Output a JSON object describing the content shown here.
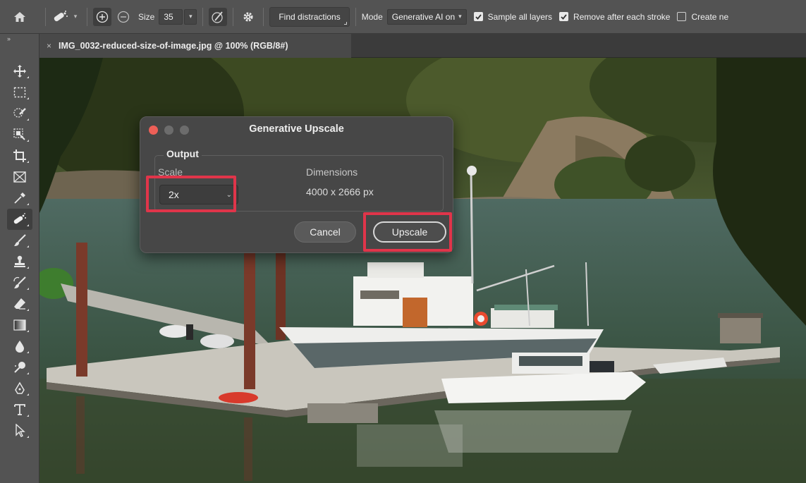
{
  "options_bar": {
    "size_label": "Size",
    "size_value": "35",
    "find_distractions": "Find distractions",
    "mode_label": "Mode",
    "mode_value": "Generative AI on",
    "sample_all_layers": "Sample all layers",
    "sample_all_layers_checked": true,
    "remove_after_stroke": "Remove after each stroke",
    "remove_after_stroke_checked": true,
    "create_new": "Create ne",
    "create_new_checked": false
  },
  "panel_collapse": "››",
  "document_tab": {
    "close": "×",
    "title": "IMG_0032-reduced-size-of-image.jpg @ 100% (RGB/8#)"
  },
  "toolbar": {
    "tools": [
      "move",
      "marquee",
      "quick-selection",
      "object-selection",
      "crop",
      "frame",
      "eyedropper",
      "remove",
      "brush",
      "clone-stamp",
      "history-brush",
      "eraser",
      "gradient",
      "blur",
      "dodge",
      "pen",
      "type",
      "path-selection"
    ],
    "active_tool": "remove"
  },
  "dialog": {
    "title": "Generative Upscale",
    "output_group": "Output",
    "scale_label": "Scale",
    "scale_value": "2x",
    "dimensions_label": "Dimensions",
    "dimensions_value": "4000 x 2666 px",
    "cancel": "Cancel",
    "upscale": "Upscale"
  },
  "colors": {
    "highlight": "#e0354a",
    "close_button": "#ed5f57",
    "dialog_bg": "#474747",
    "optbar_bg": "#535353"
  }
}
